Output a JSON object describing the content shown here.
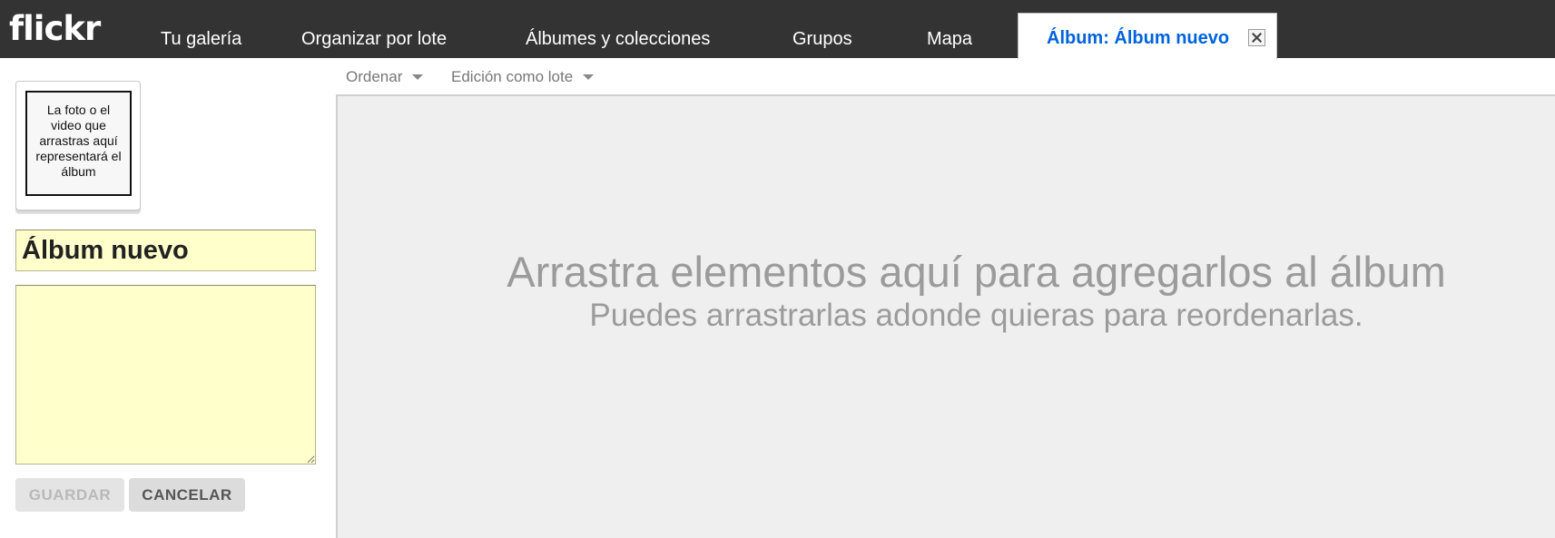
{
  "brand": {
    "logo": "flickr"
  },
  "nav": {
    "tabs": [
      {
        "label": "Tu galería"
      },
      {
        "label": "Organizar por lote"
      },
      {
        "label": "Álbumes y colecciones"
      },
      {
        "label": "Grupos"
      },
      {
        "label": "Mapa"
      }
    ],
    "active_tab": {
      "label": "Álbum: Álbum nuevo",
      "close_icon": "close-icon"
    }
  },
  "sidebar": {
    "thumbnail_placeholder": "La foto o el video que arrastras aquí representará el álbum",
    "title_value": "Álbum nuevo",
    "description_value": "",
    "save_label": "GUARDAR",
    "cancel_label": "CANCELAR"
  },
  "toolbar": {
    "sort_label": "Ordenar",
    "batch_edit_label": "Edición como lote"
  },
  "drop_area": {
    "heading": "Arrastra elementos aquí para agregarlos al álbum",
    "subheading": "Puedes arrastrarlas adonde quieras para reordenarlas."
  },
  "colors": {
    "topbar": "#333333",
    "active_tab_text": "#0063dc",
    "input_bg": "#ffffcc",
    "drop_bg": "#efefef"
  }
}
